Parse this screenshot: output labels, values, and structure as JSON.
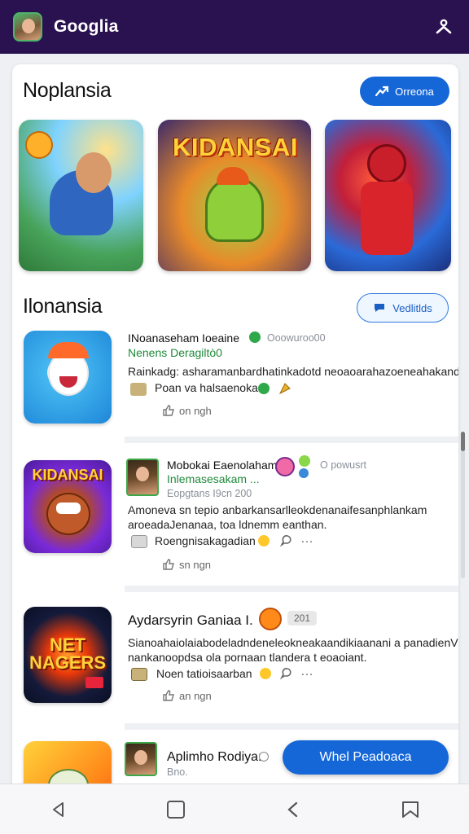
{
  "app": {
    "title": "Googlia"
  },
  "featured": {
    "title": "Noplansia",
    "button_label": "Orreona",
    "tiles": [
      {
        "banner": ""
      },
      {
        "banner": "KIDANSAI"
      },
      {
        "banner": ""
      }
    ]
  },
  "list_section": {
    "title": "Ilonansia",
    "button_label": "Vedlitlds"
  },
  "items": [
    {
      "title": "INoanaseham Ioeaine",
      "meta": "Ooowuroo00",
      "subtitle": "Nenens Deragiltò0",
      "desc_1": "Rainkadg: asharamanbardhatinkadotd neoaoarahazoeneahakand",
      "desc_2": "Poan va halsaenokar.",
      "time": "on ngh"
    },
    {
      "icon_word": "KIDANSAI",
      "title": "Mobokai Eaenolaham",
      "subtitle": "Inlemasesakam ...",
      "meta_right": "O powusrt",
      "meta": "Eopgtans I9cn 200",
      "desc_1": "Amoneva sn tepio anbarkansarlleokdenanaifesanphlankam",
      "desc_2": "aroeadaJenanaa, toa ldnemm eanthan.",
      "desc_3": "Roengnisakagadian",
      "time": "sn ngn"
    },
    {
      "icon_word": "NET\nNAGERS",
      "title": "Aydarsyrin Ganiaa I.",
      "badge": "201",
      "desc_1": "Sianoahaiolaiabodeladndeneleokneakaandikiaanani a panadienV",
      "desc_2": "nankanoopdsa ola pornaan tlandera t eoaoiant.",
      "desc_3": "Noen tatioisaarban",
      "time": "an ngn"
    },
    {
      "title": "Aplimho Rodiya:",
      "meta": "Bno."
    }
  ],
  "fab": {
    "label": "Whel Peadoaca"
  }
}
